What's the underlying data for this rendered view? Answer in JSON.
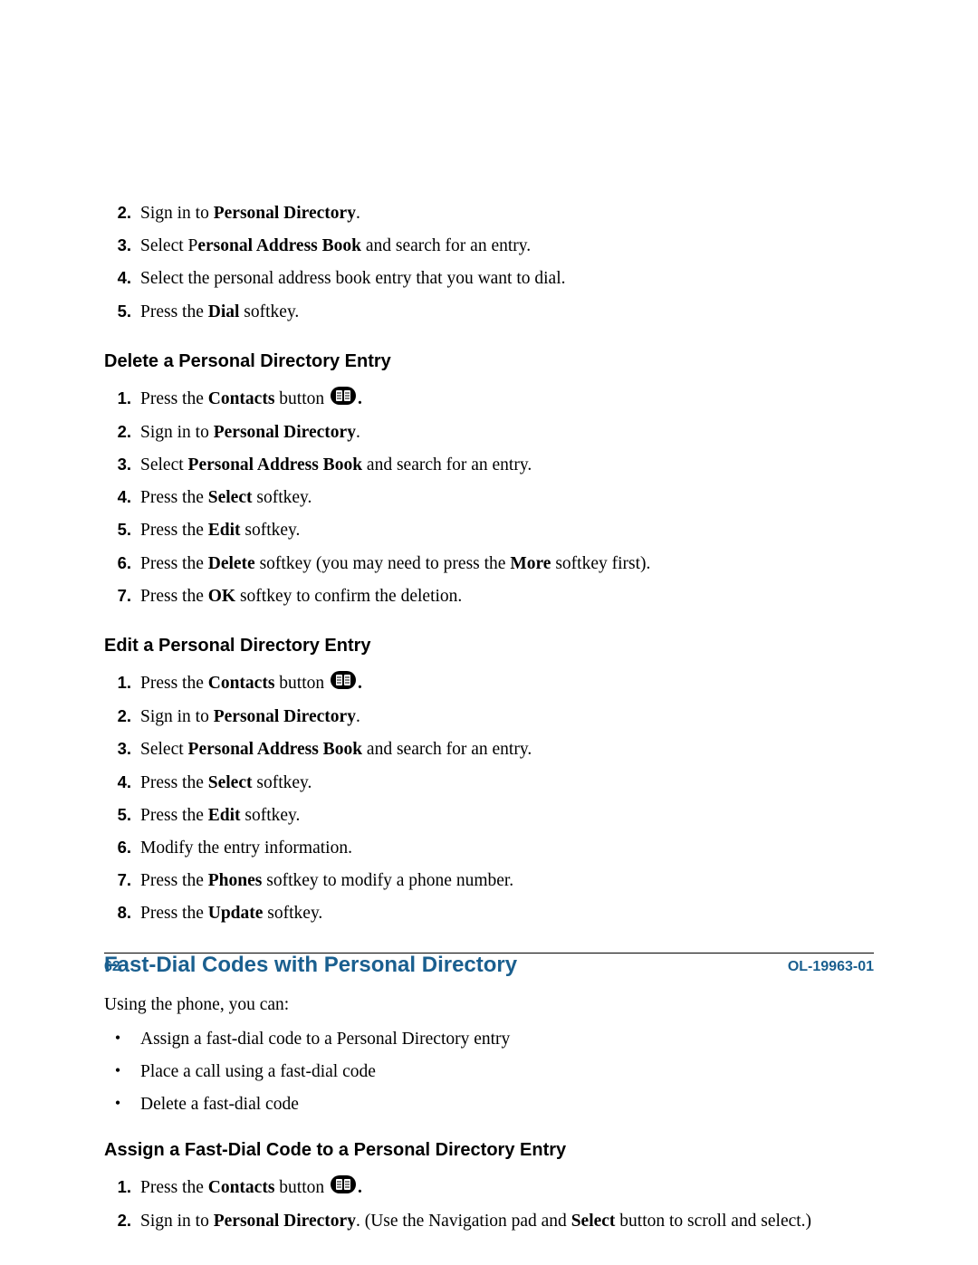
{
  "intro_list": [
    {
      "num": "2.",
      "parts": [
        {
          "t": "Sign in to "
        },
        {
          "t": "Personal Directory",
          "b": true
        },
        {
          "t": "."
        }
      ]
    },
    {
      "num": "3.",
      "parts": [
        {
          "t": "Select P"
        },
        {
          "t": "ersonal Address Book",
          "b": true
        },
        {
          "t": " and search for an entry."
        }
      ]
    },
    {
      "num": "4.",
      "parts": [
        {
          "t": "Select the personal address book entry that you want to dial."
        }
      ]
    },
    {
      "num": "5.",
      "parts": [
        {
          "t": "Press the "
        },
        {
          "t": "Dial",
          "b": true
        },
        {
          "t": " softkey."
        }
      ]
    }
  ],
  "sections": [
    {
      "heading": "Delete a Personal Directory Entry",
      "items": [
        {
          "num": "1.",
          "icon": true,
          "parts": [
            {
              "t": "Press the "
            },
            {
              "t": "Contacts",
              "b": true
            },
            {
              "t": " button "
            }
          ],
          "tail": "."
        },
        {
          "num": "2.",
          "parts": [
            {
              "t": "Sign in to "
            },
            {
              "t": "Personal Directory",
              "b": true
            },
            {
              "t": "."
            }
          ]
        },
        {
          "num": "3.",
          "parts": [
            {
              "t": "Select "
            },
            {
              "t": "Personal Address Book",
              "b": true
            },
            {
              "t": " and search for an entry."
            }
          ]
        },
        {
          "num": "4.",
          "parts": [
            {
              "t": "Press the "
            },
            {
              "t": "Select",
              "b": true
            },
            {
              "t": " softkey."
            }
          ]
        },
        {
          "num": "5.",
          "parts": [
            {
              "t": "Press the "
            },
            {
              "t": "Edit",
              "b": true
            },
            {
              "t": " softkey."
            }
          ]
        },
        {
          "num": "6.",
          "parts": [
            {
              "t": "Press the "
            },
            {
              "t": "Delete",
              "b": true
            },
            {
              "t": " softkey (you may need to press the "
            },
            {
              "t": "More",
              "b": true
            },
            {
              "t": " softkey first)."
            }
          ]
        },
        {
          "num": "7.",
          "parts": [
            {
              "t": "Press the "
            },
            {
              "t": "OK",
              "b": true
            },
            {
              "t": " softkey to confirm the deletion."
            }
          ]
        }
      ]
    },
    {
      "heading": "Edit a Personal Directory Entry",
      "items": [
        {
          "num": "1.",
          "icon": true,
          "parts": [
            {
              "t": "Press the "
            },
            {
              "t": "Contacts",
              "b": true
            },
            {
              "t": " button "
            }
          ],
          "tail": "."
        },
        {
          "num": "2.",
          "parts": [
            {
              "t": "Sign in to "
            },
            {
              "t": "Personal Directory",
              "b": true
            },
            {
              "t": "."
            }
          ]
        },
        {
          "num": "3.",
          "parts": [
            {
              "t": "Select "
            },
            {
              "t": "Personal Address Book",
              "b": true
            },
            {
              "t": " and search for an entry."
            }
          ]
        },
        {
          "num": "4.",
          "parts": [
            {
              "t": "Press the "
            },
            {
              "t": "Select",
              "b": true
            },
            {
              "t": " softkey."
            }
          ]
        },
        {
          "num": "5.",
          "parts": [
            {
              "t": "Press the "
            },
            {
              "t": "Edit",
              "b": true
            },
            {
              "t": " softkey."
            }
          ]
        },
        {
          "num": "6.",
          "parts": [
            {
              "t": "Modify the entry information."
            }
          ]
        },
        {
          "num": "7.",
          "parts": [
            {
              "t": "Press the "
            },
            {
              "t": "Phones",
              "b": true
            },
            {
              "t": " softkey to modify a phone number."
            }
          ]
        },
        {
          "num": "8.",
          "parts": [
            {
              "t": "Press the "
            },
            {
              "t": "Update",
              "b": true
            },
            {
              "t": " softkey."
            }
          ]
        }
      ]
    }
  ],
  "main_heading": "Fast-Dial Codes with Personal Directory",
  "main_intro": "Using the phone, you can:",
  "bullets": [
    "Assign a fast-dial code to a Personal Directory entry",
    "Place a call using a fast-dial code",
    "Delete a fast-dial code"
  ],
  "assign_heading": "Assign a Fast-Dial Code to a Personal Directory Entry",
  "assign_items": [
    {
      "num": "1.",
      "icon": true,
      "parts": [
        {
          "t": "Press the "
        },
        {
          "t": "Contacts",
          "b": true
        },
        {
          "t": " button "
        }
      ],
      "tail": "."
    },
    {
      "num": "2.",
      "parts": [
        {
          "t": "Sign in to "
        },
        {
          "t": "Personal Directory",
          "b": true
        },
        {
          "t": ". (Use the Navigation pad and "
        },
        {
          "t": "Select",
          "b": true
        },
        {
          "t": " button to scroll and select.)"
        }
      ]
    }
  ],
  "footer": {
    "page": "62",
    "doc": "OL-19963-01"
  }
}
